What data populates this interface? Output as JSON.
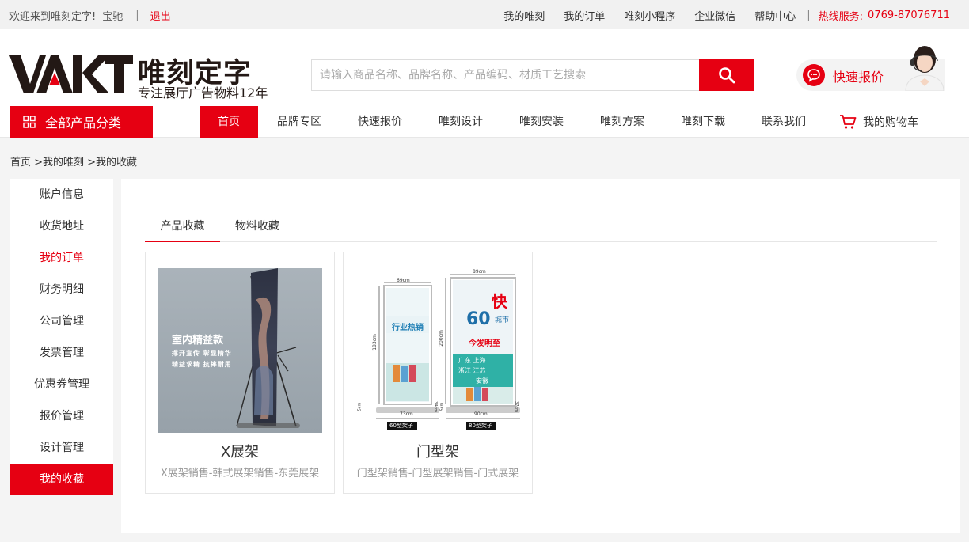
{
  "topbar": {
    "welcome": "欢迎来到唯刻定字!",
    "username": "宝驰",
    "logout": "退出",
    "links": [
      "我的唯刻",
      "我的订单",
      "唯刻小程序",
      "企业微信",
      "帮助中心"
    ],
    "hotline_label": "热线服务:",
    "hotline_number": "0769-87076711"
  },
  "header": {
    "logo_mark": "VAKT",
    "logo_name": "唯刻定字",
    "logo_slogan": "专注展厅广告物料12年",
    "search_placeholder": "请输入商品名称、品牌名称、产品编码、材质工艺搜索",
    "quote_label": "快速报价"
  },
  "nav": {
    "all_categories": "全部产品分类",
    "items": [
      "首页",
      "品牌专区",
      "快速报价",
      "唯刻设计",
      "唯刻安装",
      "唯刻方案",
      "唯刻下载",
      "联系我们"
    ],
    "cart": "我的购物车"
  },
  "breadcrumb": "首页 >我的唯刻 >我的收藏",
  "sidebar": {
    "items": [
      "账户信息",
      "收货地址",
      "我的订单",
      "财务明细",
      "公司管理",
      "发票管理",
      "优惠券管理",
      "报价管理",
      "设计管理",
      "我的收藏"
    ]
  },
  "tabs": [
    "产品收藏",
    "物料收藏"
  ],
  "products": [
    {
      "title": "X展架",
      "desc": "X展架销售-韩式展架销售-东莞展架",
      "img_text": {
        "heading": "室内精益款",
        "line1": "撑开宣传 彰显精华",
        "line2": "精益求精 抗摔耐用"
      }
    },
    {
      "title": "门型架",
      "desc": "门型架销售-门型展架销售-门式展架",
      "img_text": {
        "left_top": "69cm",
        "left_height": "183cm",
        "left_bottom": "73cm",
        "left_tag": "60型架子",
        "left_banner": "行业热销",
        "right_top": "89cm",
        "right_height": "200cm",
        "right_bottom": "90cm",
        "right_tag": "80型架子",
        "right_big": "快",
        "right_num": "60",
        "right_city": "城市",
        "right_red": "今发明至",
        "cities": [
          "广东",
          "上海",
          "浙江",
          "江苏",
          "安徽"
        ],
        "depth_left": "5cm",
        "depth_right": "5cm",
        "base_left": "34cm",
        "base_right": "37cm"
      }
    }
  ],
  "colors": {
    "brand_red": "#e60012",
    "text": "#333333",
    "muted": "#999999"
  }
}
